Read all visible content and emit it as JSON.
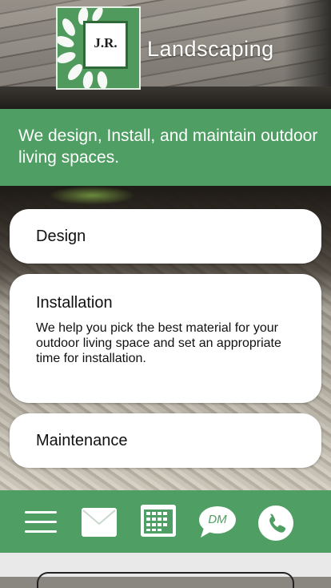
{
  "brand": {
    "logo_text": "J.R.",
    "name": "Landscaping"
  },
  "tagline": "We design, Install, and maintain outdoor living spaces.",
  "services": [
    {
      "title": "Design"
    },
    {
      "title": "Installation",
      "description": "We help you pick the best material for your outdoor living space and set an appropriate time for installation."
    },
    {
      "title": "Maintenance"
    }
  ],
  "nav": {
    "items": [
      {
        "icon": "hamburger-menu-icon"
      },
      {
        "icon": "mail-icon"
      },
      {
        "icon": "calendar-icon"
      },
      {
        "icon": "chat-bubble-icon",
        "label": "DM"
      },
      {
        "icon": "phone-icon"
      }
    ]
  },
  "colors": {
    "brand_green": "#4f9e63",
    "logo_green": "#4f9a5c",
    "card_bg": "#ffffff"
  }
}
